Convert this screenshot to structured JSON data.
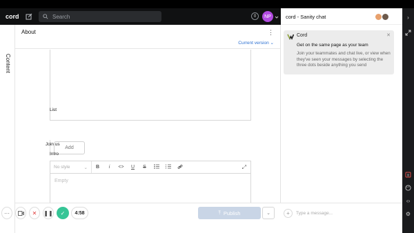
{
  "header": {
    "brand": "cord",
    "search_placeholder": "Search",
    "notification_count": "0",
    "avatar_initials": "NP"
  },
  "leftrail": {
    "tab_label": "Content"
  },
  "document": {
    "title": "About",
    "version_label": "Current version",
    "list_label": "List",
    "add_button": "Add",
    "section_label": "Join us",
    "intro_label": "Intro",
    "style_select": "No style",
    "editor_placeholder": "Empty",
    "toolbar": {
      "bold": "B",
      "italic": "i",
      "code": "<>",
      "underline": "U",
      "strike": "S"
    }
  },
  "actions": {
    "publish_label": "Publish"
  },
  "recorder": {
    "time": "4:58"
  },
  "chat": {
    "title": "cord - Sanity chat",
    "card": {
      "name": "Cord",
      "heading": "Get on the same page as your team",
      "body": "Join your teammates and chat live, or view when they've seen your messages by selecting the three dots beside anything you send"
    },
    "input_placeholder": "Type a message..."
  },
  "colors": {
    "topbar": "#101112",
    "avatar": "#b14be0",
    "accent_link": "#2a6fd1",
    "publish_disabled": "#c9d5e6",
    "confirm_green": "#36c596"
  }
}
